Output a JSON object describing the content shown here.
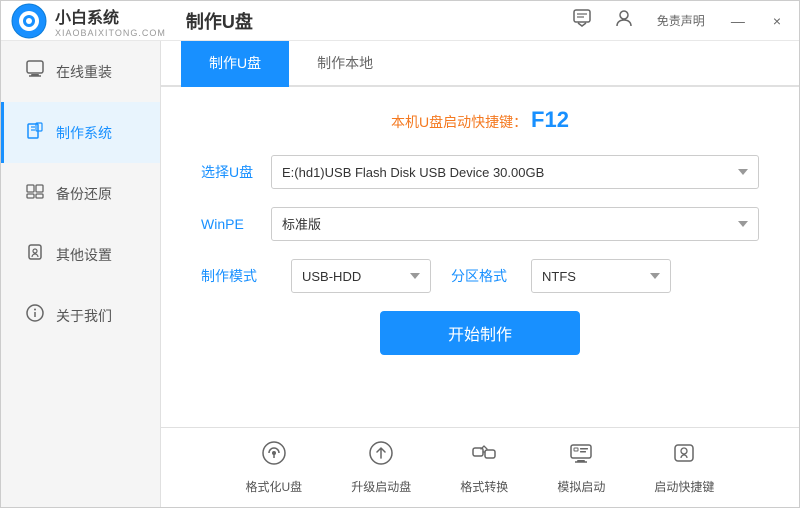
{
  "titlebar": {
    "logo_main": "小白系统",
    "logo_sub": "XIAOBAIXITONG.COM",
    "title": "制作U盘",
    "icon_feedback": "💬",
    "icon_help": "👤",
    "disclaimer": "免责声明",
    "btn_min": "—",
    "btn_close": "×"
  },
  "sidebar": {
    "items": [
      {
        "id": "online-reinstall",
        "label": "在线重装",
        "icon": "🖥"
      },
      {
        "id": "make-system",
        "label": "制作系统",
        "icon": "💾"
      },
      {
        "id": "backup-restore",
        "label": "备份还原",
        "icon": "🗂"
      },
      {
        "id": "other-settings",
        "label": "其他设置",
        "icon": "🔒"
      },
      {
        "id": "about-us",
        "label": "关于我们",
        "icon": "ℹ"
      }
    ]
  },
  "tabs": [
    {
      "id": "make-usb",
      "label": "制作U盘",
      "active": true
    },
    {
      "id": "make-local",
      "label": "制作本地",
      "active": false
    }
  ],
  "form": {
    "shortcut_hint": "本机U盘启动快捷键：",
    "shortcut_key": "F12",
    "fields": [
      {
        "id": "select-usb",
        "label": "选择U盘",
        "value": "E:(hd1)USB Flash Disk USB Device 30.00GB",
        "type": "select"
      },
      {
        "id": "winpe",
        "label": "WinPE",
        "value": "标准版",
        "type": "select"
      }
    ],
    "mode_label": "制作模式",
    "mode_value": "USB-HDD",
    "partition_label": "分区格式",
    "partition_value": "NTFS",
    "start_btn": "开始制作"
  },
  "bottom_tools": [
    {
      "id": "format-usb",
      "label": "格式化U盘",
      "icon": "⊙"
    },
    {
      "id": "upgrade-boot",
      "label": "升级启动盘",
      "icon": "⊕"
    },
    {
      "id": "format-convert",
      "label": "格式转换",
      "icon": "⇄"
    },
    {
      "id": "simulate-boot",
      "label": "模拟启动",
      "icon": "⌨"
    },
    {
      "id": "boot-shortcut",
      "label": "启动快捷键",
      "icon": "🔒"
    }
  ]
}
